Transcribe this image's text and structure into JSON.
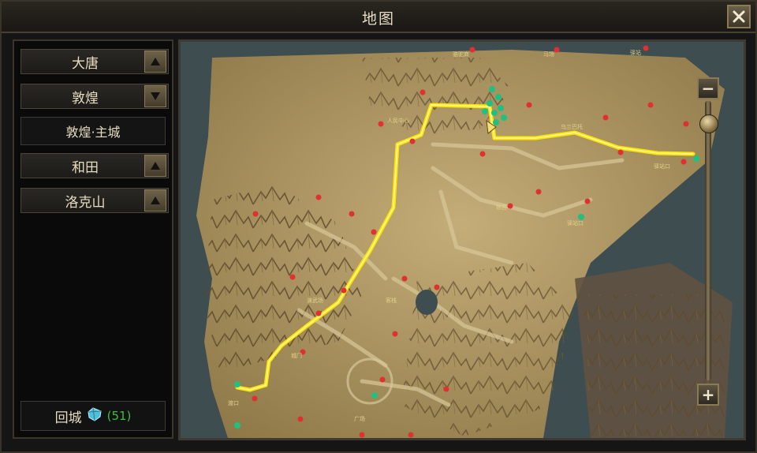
{
  "window": {
    "title": "地图"
  },
  "sidebar": {
    "regions": [
      {
        "label": "大唐",
        "arrow": "up-arrow-icon"
      },
      {
        "label": "敦煌",
        "arrow": "down-arrow-icon"
      },
      {
        "label": "和田",
        "arrow": "up-arrow-icon"
      },
      {
        "label": "洛克山",
        "arrow": "up-arrow-icon"
      }
    ],
    "selected_sub": "敦煌·主城",
    "recall": {
      "label": "回城",
      "icon": "teleport-gem-icon",
      "count": "(51)"
    }
  },
  "map": {
    "route_color": "#ffe400",
    "terrain_color": "#b39a62",
    "water_color": "#3e4f52",
    "npc_color": "#e03030",
    "portal_color": "#20c080",
    "zoom_in": "+",
    "zoom_out": "−",
    "zoom_level_fraction": 0.05
  }
}
